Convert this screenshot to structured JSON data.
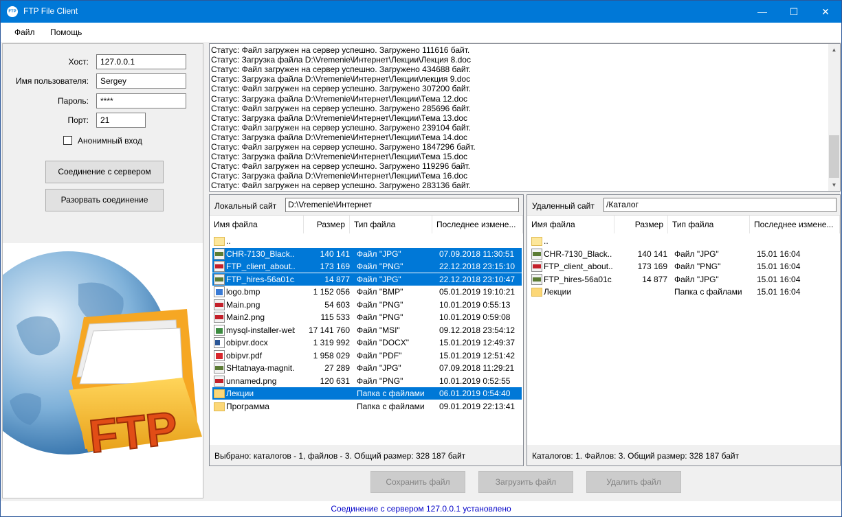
{
  "window": {
    "title": "FTP File Client",
    "icon_text": "FTP",
    "minimize": "—",
    "maximize": "☐",
    "close": "✕"
  },
  "menu": [
    "Файл",
    "Помощь"
  ],
  "connection": {
    "host_label": "Хост:",
    "host_value": "127.0.0.1",
    "user_label": "Имя пользователя:",
    "user_value": "Sergey",
    "password_label": "Пароль:",
    "password_value": "****",
    "port_label": "Порт:",
    "port_value": "21",
    "anonymous_label": "Анонимный вход",
    "anonymous_checked": false,
    "connect_button": "Соединение с сервером",
    "disconnect_button": "Разорвать соединение"
  },
  "log": {
    "lines": [
      "Статус:  Файл загружен на сервер успешно. Загружено 111616 байт.",
      "Статус:  Загрузка файла D:\\Vremenie\\Интернет\\Лекции\\Лекция 8.doc",
      "Статус:  Файл загружен на сервер успешно. Загружено 434688 байт.",
      "Статус:  Загрузка файла D:\\Vremenie\\Интернет\\Лекции\\лекция 9.doc",
      "Статус:  Файл загружен на сервер успешно. Загружено 307200 байт.",
      "Статус:  Загрузка файла D:\\Vremenie\\Интернет\\Лекции\\Тема 12.doc",
      "Статус:  Файл загружен на сервер успешно. Загружено 285696 байт.",
      "Статус:  Загрузка файла D:\\Vremenie\\Интернет\\Лекции\\Тема 13.doc",
      "Статус:  Файл загружен на сервер успешно. Загружено 239104 байт.",
      "Статус:  Загрузка файла D:\\Vremenie\\Интернет\\Лекции\\Тема 14.doc",
      "Статус:  Файл загружен на сервер успешно. Загружено 1847296 байт.",
      "Статус:  Загрузка файла D:\\Vremenie\\Интернет\\Лекции\\Тема 15.doc",
      "Статус:  Файл загружен на сервер успешно. Загружено 119296 байт.",
      "Статус:  Загрузка файла D:\\Vremenie\\Интернет\\Лекции\\Тема 16.doc",
      "Статус:  Файл загружен на сервер успешно. Загружено 283136 байт."
    ],
    "scroll_up": "▲",
    "scroll_down": "▼"
  },
  "local": {
    "label": "Локальный сайт",
    "path": "D:\\Vremenie\\Интернет",
    "columns": [
      "Имя файла",
      "Размер",
      "Тип файла",
      "Последнее измене..."
    ],
    "rows": [
      {
        "icon": "folder-up-icon",
        "name": "..",
        "size": "",
        "type": "",
        "date": "",
        "selected": false
      },
      {
        "icon": "jpg-file-icon",
        "name": "CHR-7130_Black...",
        "size": "140 141",
        "type": "Файл \"JPG\"",
        "date": "07.09.2018 11:30:51",
        "selected": true
      },
      {
        "icon": "png-file-icon",
        "name": "FTP_client_about....",
        "size": "173 169",
        "type": "Файл \"PNG\"",
        "date": "22.12.2018 23:15:10",
        "selected": true
      },
      {
        "icon": "jpg-file-icon",
        "name": "FTP_hires-56a01c...",
        "size": "14 877",
        "type": "Файл \"JPG\"",
        "date": "22.12.2018 23:10:47",
        "selected": true
      },
      {
        "icon": "bmp-file-icon",
        "name": "logo.bmp",
        "size": "1 152 056",
        "type": "Файл \"BMP\"",
        "date": "05.01.2019 19:10:21",
        "selected": false
      },
      {
        "icon": "png-file-icon",
        "name": "Main.png",
        "size": "54 603",
        "type": "Файл \"PNG\"",
        "date": "10.01.2019 0:55:13",
        "selected": false
      },
      {
        "icon": "png-file-icon",
        "name": "Main2.png",
        "size": "115 533",
        "type": "Файл \"PNG\"",
        "date": "10.01.2019 0:59:08",
        "selected": false
      },
      {
        "icon": "msi-file-icon",
        "name": "mysql-installer-web...",
        "size": "17 141 760",
        "type": "Файл \"MSI\"",
        "date": "09.12.2018 23:54:12",
        "selected": false
      },
      {
        "icon": "docx-file-icon",
        "name": "obipvr.docx",
        "size": "1 319 992",
        "type": "Файл \"DOCX\"",
        "date": "15.01.2019 12:49:37",
        "selected": false
      },
      {
        "icon": "pdf-file-icon",
        "name": "obipvr.pdf",
        "size": "1 958 029",
        "type": "Файл \"PDF\"",
        "date": "15.01.2019 12:51:42",
        "selected": false
      },
      {
        "icon": "jpg-file-icon",
        "name": "SHtatnaya-magnit...",
        "size": "27 289",
        "type": "Файл \"JPG\"",
        "date": "07.09.2018 11:29:21",
        "selected": false
      },
      {
        "icon": "png-file-icon",
        "name": "unnamed.png",
        "size": "120 631",
        "type": "Файл \"PNG\"",
        "date": "10.01.2019 0:52:55",
        "selected": false
      },
      {
        "icon": "folder-icon",
        "name": "Лекции",
        "size": "",
        "type": "Папка с файлами",
        "date": "06.01.2019 0:54:40",
        "selected": true
      },
      {
        "icon": "folder-icon",
        "name": "Программа",
        "size": "",
        "type": "Папка с файлами",
        "date": "09.01.2019 22:13:41",
        "selected": false
      }
    ],
    "status": "Выбрано: каталогов - 1, файлов - 3. Общий размер: 328 187 байт"
  },
  "remote": {
    "label": "Удаленный сайт",
    "path": "/Каталог",
    "columns": [
      "Имя файла",
      "Размер",
      "Тип файла",
      "Последнее измене..."
    ],
    "rows": [
      {
        "icon": "folder-up-icon",
        "name": "..",
        "size": "",
        "type": "",
        "date": "",
        "selected": false
      },
      {
        "icon": "jpg-file-icon",
        "name": "CHR-7130_Black...",
        "size": "140 141",
        "type": "Файл \"JPG\"",
        "date": "15.01 16:04",
        "selected": false
      },
      {
        "icon": "png-file-icon",
        "name": "FTP_client_about....",
        "size": "173 169",
        "type": "Файл \"PNG\"",
        "date": "15.01 16:04",
        "selected": false
      },
      {
        "icon": "jpg-file-icon",
        "name": "FTP_hires-56a01c...",
        "size": "14 877",
        "type": "Файл \"JPG\"",
        "date": "15.01 16:04",
        "selected": false
      },
      {
        "icon": "folder-icon",
        "name": "Лекции",
        "size": "",
        "type": "Папка с файлами",
        "date": "15.01 16:04",
        "selected": false
      }
    ],
    "status": "Каталогов: 1. Файлов: 3. Общий размер: 328 187 байт"
  },
  "actions": {
    "save": "Сохранить файл",
    "upload": "Загрузить файл",
    "delete": "Удалить файл"
  },
  "statusbar": "Соединение с сервером 127.0.0.1 установлено",
  "logo_text": "FTP",
  "colors": {
    "titlebar": "#0078d7",
    "selection": "#0078d7",
    "status_text": "#0000c8"
  }
}
